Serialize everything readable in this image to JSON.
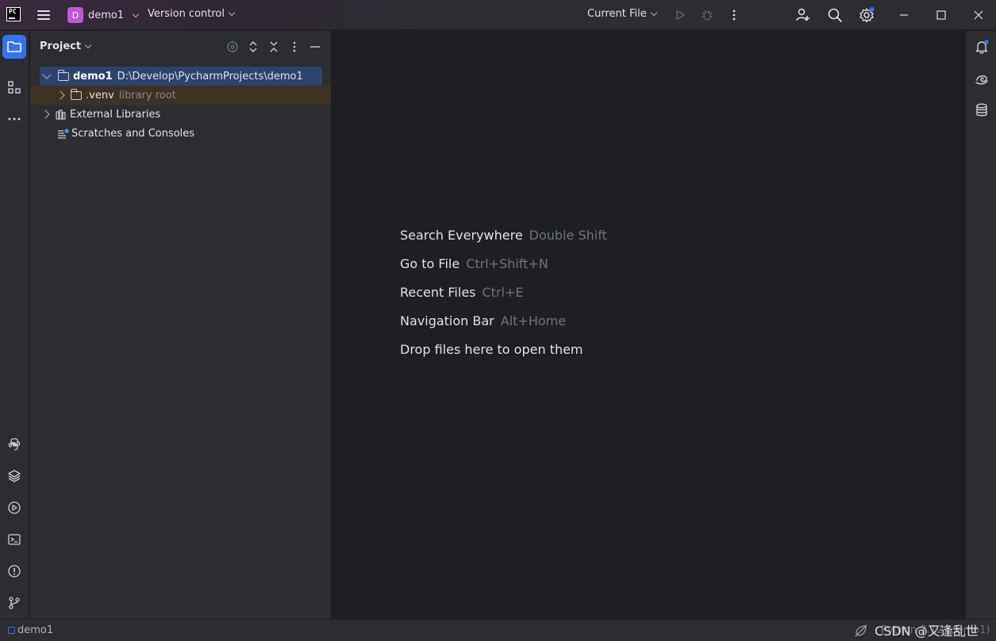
{
  "titlebar": {
    "project_badge": "D",
    "project_name": "demo1",
    "vcs_label": "Version control",
    "run_config": "Current File"
  },
  "project_panel": {
    "title": "Project",
    "tree": [
      {
        "name": "demo1",
        "detail": "D:\\Develop\\PycharmProjects\\demo1"
      },
      {
        "name": ".venv",
        "detail": "library root"
      },
      {
        "name": "External Libraries"
      },
      {
        "name": "Scratches and Consoles"
      }
    ]
  },
  "editor": {
    "hints": [
      {
        "label": "Search Everywhere",
        "shortcut": "Double Shift"
      },
      {
        "label": "Go to File",
        "shortcut": "Ctrl+Shift+N"
      },
      {
        "label": "Recent Files",
        "shortcut": "Ctrl+E"
      },
      {
        "label": "Navigation Bar",
        "shortcut": "Alt+Home"
      },
      {
        "label": "Drop files here to open them",
        "shortcut": ""
      }
    ]
  },
  "statusbar": {
    "breadcrumb": "demo1",
    "interpreter": "Python 3.12 (demo1)",
    "watermark": "CSDN @又逢乱世"
  },
  "colors": {
    "accent": "#3574f0",
    "project_badge": "#c158d8",
    "selection": "#2e436e",
    "notification_dot": "#3574f0"
  }
}
